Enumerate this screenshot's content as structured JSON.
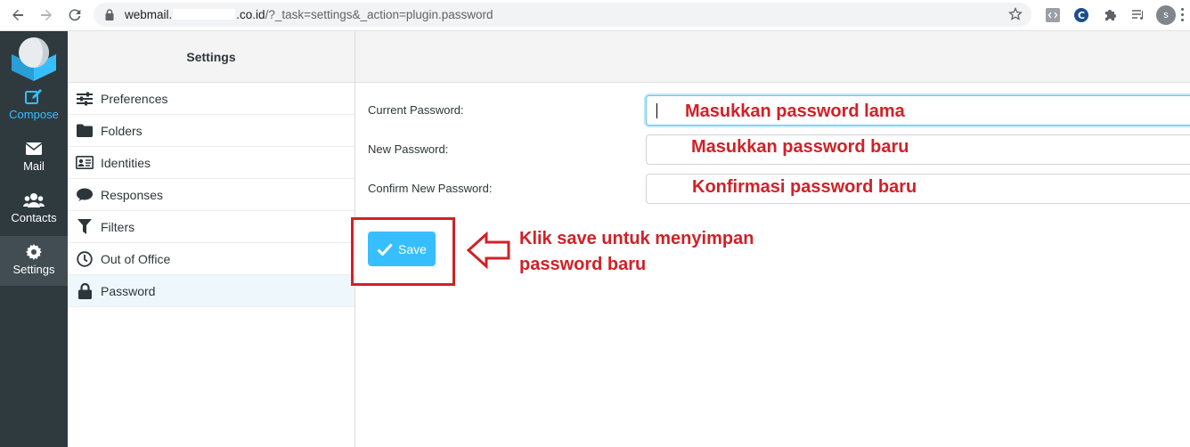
{
  "browser": {
    "url_prefix": "webmail.",
    "url_domain_suffix": ".co.id",
    "url_path": "/?_task=settings&_action=plugin.password",
    "profile_initial": "s",
    "icons": [
      "back-icon",
      "forward-icon",
      "reload-icon",
      "lock-icon",
      "star-icon",
      "code-extension-icon",
      "c-extension-icon",
      "puzzle-icon",
      "reading-list-icon"
    ]
  },
  "taskbar": {
    "items": [
      {
        "label": "Compose",
        "icon": "compose-icon"
      },
      {
        "label": "Mail",
        "icon": "envelope-icon"
      },
      {
        "label": "Contacts",
        "icon": "users-icon"
      },
      {
        "label": "Settings",
        "icon": "gear-icon"
      }
    ],
    "accent_color": "#37beff"
  },
  "settings": {
    "title": "Settings",
    "items": [
      {
        "label": "Preferences",
        "icon": "sliders-icon"
      },
      {
        "label": "Folders",
        "icon": "folder-icon"
      },
      {
        "label": "Identities",
        "icon": "id-card-icon"
      },
      {
        "label": "Responses",
        "icon": "comment-icon"
      },
      {
        "label": "Filters",
        "icon": "filter-icon"
      },
      {
        "label": "Out of Office",
        "icon": "clock-icon"
      },
      {
        "label": "Password",
        "icon": "lock-icon"
      }
    ],
    "selected": "Password"
  },
  "form": {
    "fields": [
      {
        "label": "Current Password:",
        "annotation": "Masukkan password lama"
      },
      {
        "label": "New Password:",
        "annotation": "Masukkan password baru"
      },
      {
        "label": "Confirm New Password:",
        "annotation": "Konfirmasi password baru"
      }
    ],
    "save_label": "Save",
    "save_annotation_line1": "Klik save untuk menyimpan",
    "save_annotation_line2": "password baru",
    "annotation_color": "#d22027"
  }
}
